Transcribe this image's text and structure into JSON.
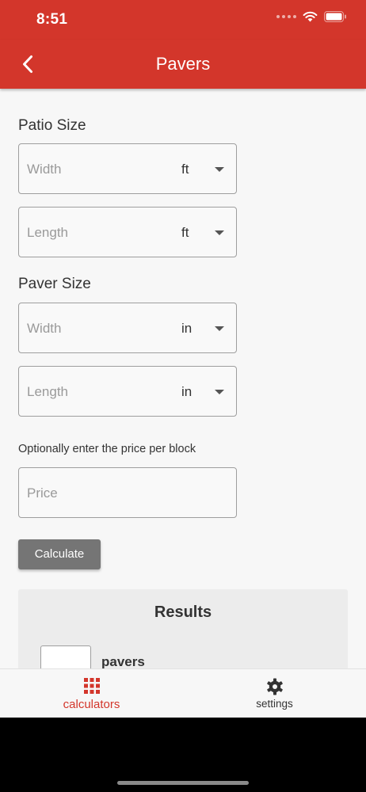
{
  "status_bar": {
    "time": "8:51"
  },
  "header": {
    "title": "Pavers",
    "back_icon": "chevron-left-icon"
  },
  "patio_size": {
    "title": "Patio Size",
    "width": {
      "placeholder": "Width",
      "unit": "ft"
    },
    "length": {
      "placeholder": "Length",
      "unit": "ft"
    }
  },
  "paver_size": {
    "title": "Paver Size",
    "width": {
      "placeholder": "Width",
      "unit": "in"
    },
    "length": {
      "placeholder": "Length",
      "unit": "in"
    }
  },
  "price": {
    "note": "Optionally enter the price per block",
    "placeholder": "Price"
  },
  "calculate_label": "Calculate",
  "results": {
    "title": "Results",
    "pavers_label": "pavers"
  },
  "tabs": [
    {
      "label": "calculators",
      "icon": "grid-icon",
      "active": true
    },
    {
      "label": "settings",
      "icon": "gear-icon",
      "active": false
    }
  ],
  "colors": {
    "brand": "#d3362b",
    "button": "#757575",
    "results_bg": "#ececec"
  }
}
